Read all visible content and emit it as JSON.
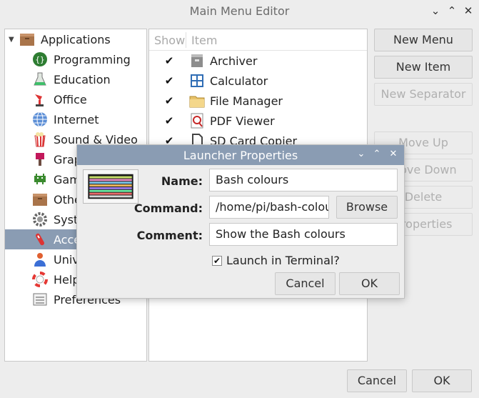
{
  "window": {
    "title": "Main Menu Editor",
    "controls": [
      "⌄",
      "⌃",
      "✕"
    ]
  },
  "tree": {
    "root": "Applications",
    "items": [
      {
        "label": "Programming",
        "icon": "programming-icon"
      },
      {
        "label": "Education",
        "icon": "education-icon"
      },
      {
        "label": "Office",
        "icon": "office-icon"
      },
      {
        "label": "Internet",
        "icon": "internet-icon"
      },
      {
        "label": "Sound & Video",
        "icon": "sound-video-icon"
      },
      {
        "label": "Graphics",
        "icon": "graphics-icon"
      },
      {
        "label": "Games",
        "icon": "games-icon"
      },
      {
        "label": "Other",
        "icon": "other-icon"
      },
      {
        "label": "System Tools",
        "icon": "system-tools-icon"
      },
      {
        "label": "Accessories",
        "icon": "accessories-icon",
        "selected": true
      },
      {
        "label": "Universal Access",
        "icon": "universal-access-icon"
      },
      {
        "label": "Help",
        "icon": "help-icon"
      },
      {
        "label": "Preferences",
        "icon": "preferences-icon"
      }
    ]
  },
  "items": {
    "header_show": "Show",
    "header_item": "Item",
    "rows": [
      {
        "label": "Archiver",
        "icon": "archiver-icon",
        "checked": true
      },
      {
        "label": "Calculator",
        "icon": "calculator-icon",
        "checked": true
      },
      {
        "label": "File Manager",
        "icon": "folder-icon",
        "checked": true
      },
      {
        "label": "PDF Viewer",
        "icon": "pdf-viewer-icon",
        "checked": true
      },
      {
        "label": "SD Card Copier",
        "icon": "sd-card-icon",
        "checked": true
      }
    ]
  },
  "side_buttons": {
    "new_menu": "New Menu",
    "new_item": "New Item",
    "new_separator": "New Separator",
    "move_up": "Move Up",
    "move_down": "Move Down",
    "delete": "Delete",
    "properties": "Properties"
  },
  "footer": {
    "cancel": "Cancel",
    "ok": "OK"
  },
  "dialog": {
    "title": "Launcher Properties",
    "controls": [
      "⌄",
      "⌃",
      "✕"
    ],
    "name_label": "Name:",
    "name_value": "Bash colours",
    "command_label": "Command:",
    "command_value": "/home/pi/bash-colours",
    "browse": "Browse",
    "comment_label": "Comment:",
    "comment_value": "Show the Bash colours",
    "terminal_label": "Launch in Terminal?",
    "terminal_checked": true,
    "cancel": "Cancel",
    "ok": "OK"
  },
  "colors": {
    "selection": "#8a9cb3",
    "background": "#ededed"
  }
}
